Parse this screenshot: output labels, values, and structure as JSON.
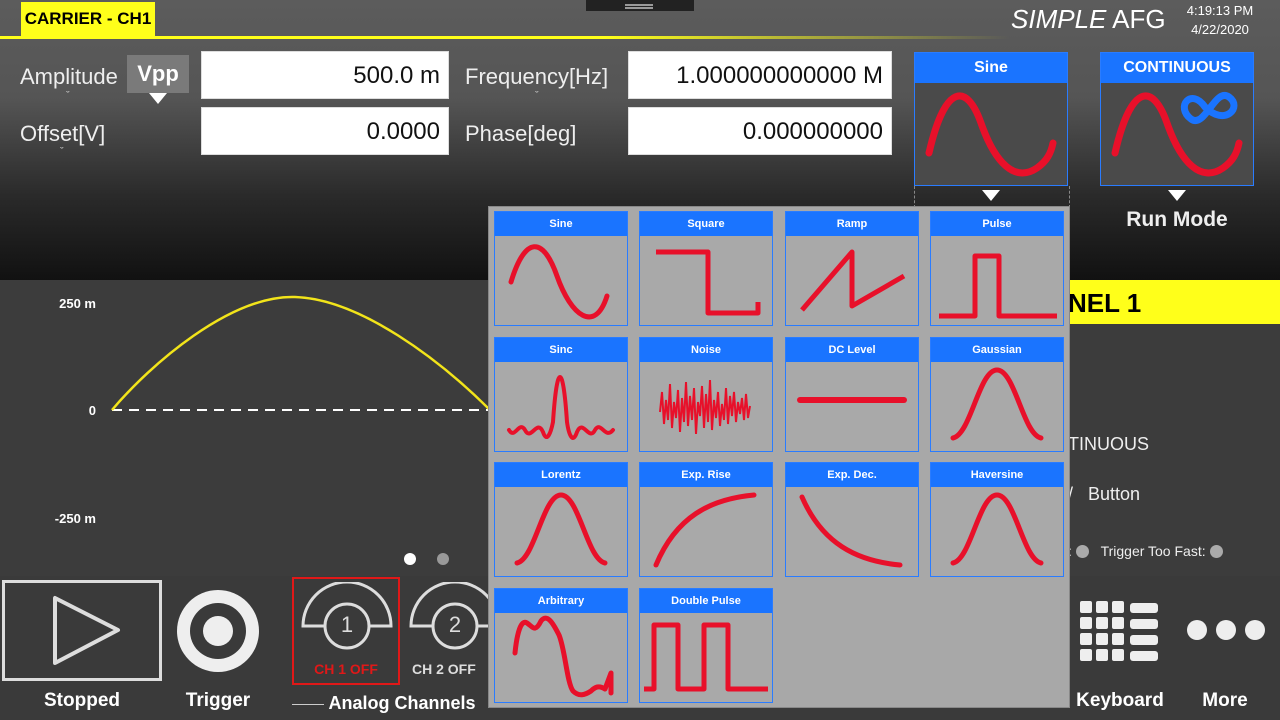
{
  "header": {
    "carrier_tab": "CARRIER - CH1",
    "brand_simple": "SIMPLE",
    "brand_afg": "AFG",
    "time": "4:19:13 PM",
    "date": "4/22/2020"
  },
  "params": {
    "amplitude_label": "Amplitude",
    "amplitude_unit": "Vpp",
    "amplitude_value": "500.0 m",
    "offset_label": "Offset[V]",
    "offset_value": "0.0000",
    "frequency_label": "Frequency[Hz]",
    "frequency_value": "1.000000000000 M",
    "phase_label": "Phase[deg]",
    "phase_value": "0.000000000"
  },
  "function_card": {
    "title": "Sine"
  },
  "run_card": {
    "title": "CONTINUOUS",
    "label": "Run Mode"
  },
  "plot": {
    "y_top": "250 m",
    "y_zero": "0",
    "y_bottom": "-250 m"
  },
  "side_panel": {
    "title_fragment": "NEL 1",
    "mode_fragment": "TINUOUS",
    "button_fragment": "Button",
    "trigger_too_fast": "Trigger Too Fast:"
  },
  "bottom_bar": {
    "stopped": "Stopped",
    "trigger": "Trigger",
    "ch1_number": "1",
    "ch1_status": "CH 1 OFF",
    "ch2_number": "2",
    "ch2_status": "CH 2 OFF",
    "analog_channels": "Analog Channels",
    "keyboard": "Keyboard",
    "more": "More"
  },
  "waveform_options": [
    {
      "label": "Sine",
      "icon": "sine-wave-icon"
    },
    {
      "label": "Square",
      "icon": "square-wave-icon"
    },
    {
      "label": "Ramp",
      "icon": "ramp-wave-icon"
    },
    {
      "label": "Pulse",
      "icon": "pulse-wave-icon"
    },
    {
      "label": "Sinc",
      "icon": "sinc-wave-icon"
    },
    {
      "label": "Noise",
      "icon": "noise-wave-icon"
    },
    {
      "label": "DC Level",
      "icon": "dc-level-icon"
    },
    {
      "label": "Gaussian",
      "icon": "gaussian-wave-icon"
    },
    {
      "label": "Lorentz",
      "icon": "lorentz-wave-icon"
    },
    {
      "label": "Exp. Rise",
      "icon": "exp-rise-icon"
    },
    {
      "label": "Exp. Dec.",
      "icon": "exp-decay-icon"
    },
    {
      "label": "Haversine",
      "icon": "haversine-wave-icon"
    },
    {
      "label": "Arbitrary",
      "icon": "arbitrary-wave-icon"
    },
    {
      "label": "Double Pulse",
      "icon": "double-pulse-icon"
    }
  ],
  "colors": {
    "accent_yellow": "#ffff1a",
    "card_blue": "#1a74ff",
    "wave_red": "#e8102a",
    "plot_yellow": "#f2e41a"
  }
}
